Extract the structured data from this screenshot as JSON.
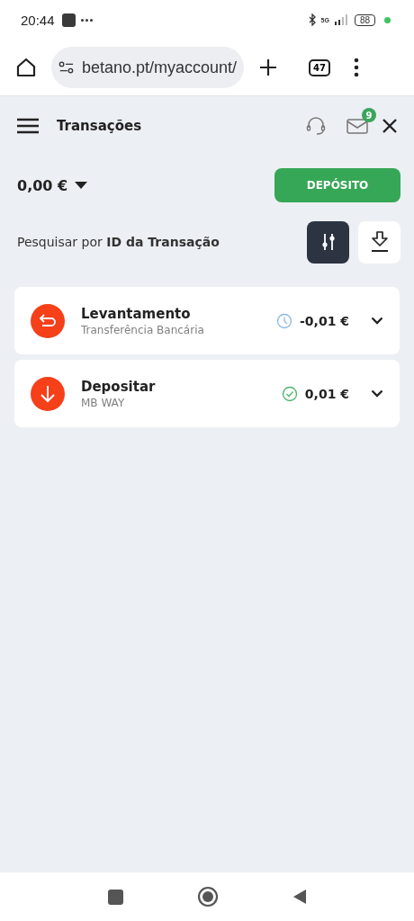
{
  "status_bar": {
    "time": "20:44",
    "network": "5G",
    "battery": "88"
  },
  "browser": {
    "url": "betano.pt/myaccount/",
    "tab_count": "47"
  },
  "header": {
    "title": "Transações",
    "unread": "9"
  },
  "balance": {
    "amount": "0,00 €",
    "deposit_button": "DEPÓSITO"
  },
  "search": {
    "label": "Pesquisar por **ID da Transação**"
  },
  "transactions": [
    {
      "kind": "withdrawal",
      "title": "Levantamento",
      "method": "Transferência Bancária",
      "completed": false,
      "amount": "-0,01 €"
    },
    {
      "kind": "deposit",
      "title": "Depositar",
      "method": "MB WAY",
      "completed": true,
      "amount": "0,01 €"
    }
  ]
}
